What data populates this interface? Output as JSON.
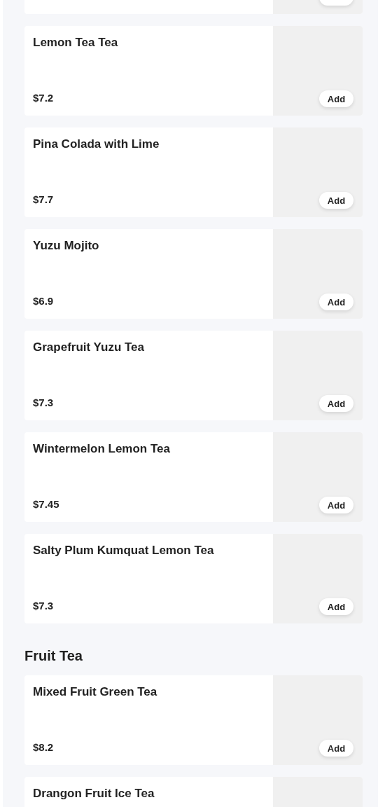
{
  "sections": [
    {
      "items": [
        {
          "kind": "cut"
        },
        {
          "kind": "item",
          "name": "Lemon Tea Tea",
          "price": "$7.2",
          "button": "Add"
        },
        {
          "kind": "item",
          "name": "Pina Colada with Lime",
          "price": "$7.7",
          "button": "Add"
        },
        {
          "kind": "item",
          "name": "Yuzu Mojito",
          "price": "$6.9",
          "button": "Add"
        },
        {
          "kind": "item",
          "name": "Grapefruit Yuzu Tea",
          "price": "$7.3",
          "button": "Add"
        },
        {
          "kind": "item",
          "name": "Wintermelon Lemon Tea",
          "price": "$7.45",
          "button": "Add"
        },
        {
          "kind": "item",
          "name": "Salty Plum Kumquat Lemon Tea",
          "price": "$7.3",
          "button": "Add"
        }
      ]
    },
    {
      "title": "Fruit Tea",
      "items": [
        {
          "kind": "item",
          "name": "Mixed Fruit Green Tea",
          "price": "$8.2",
          "button": "Add"
        },
        {
          "kind": "item",
          "name": "Drangon Fruit Ice Tea"
        }
      ]
    }
  ]
}
